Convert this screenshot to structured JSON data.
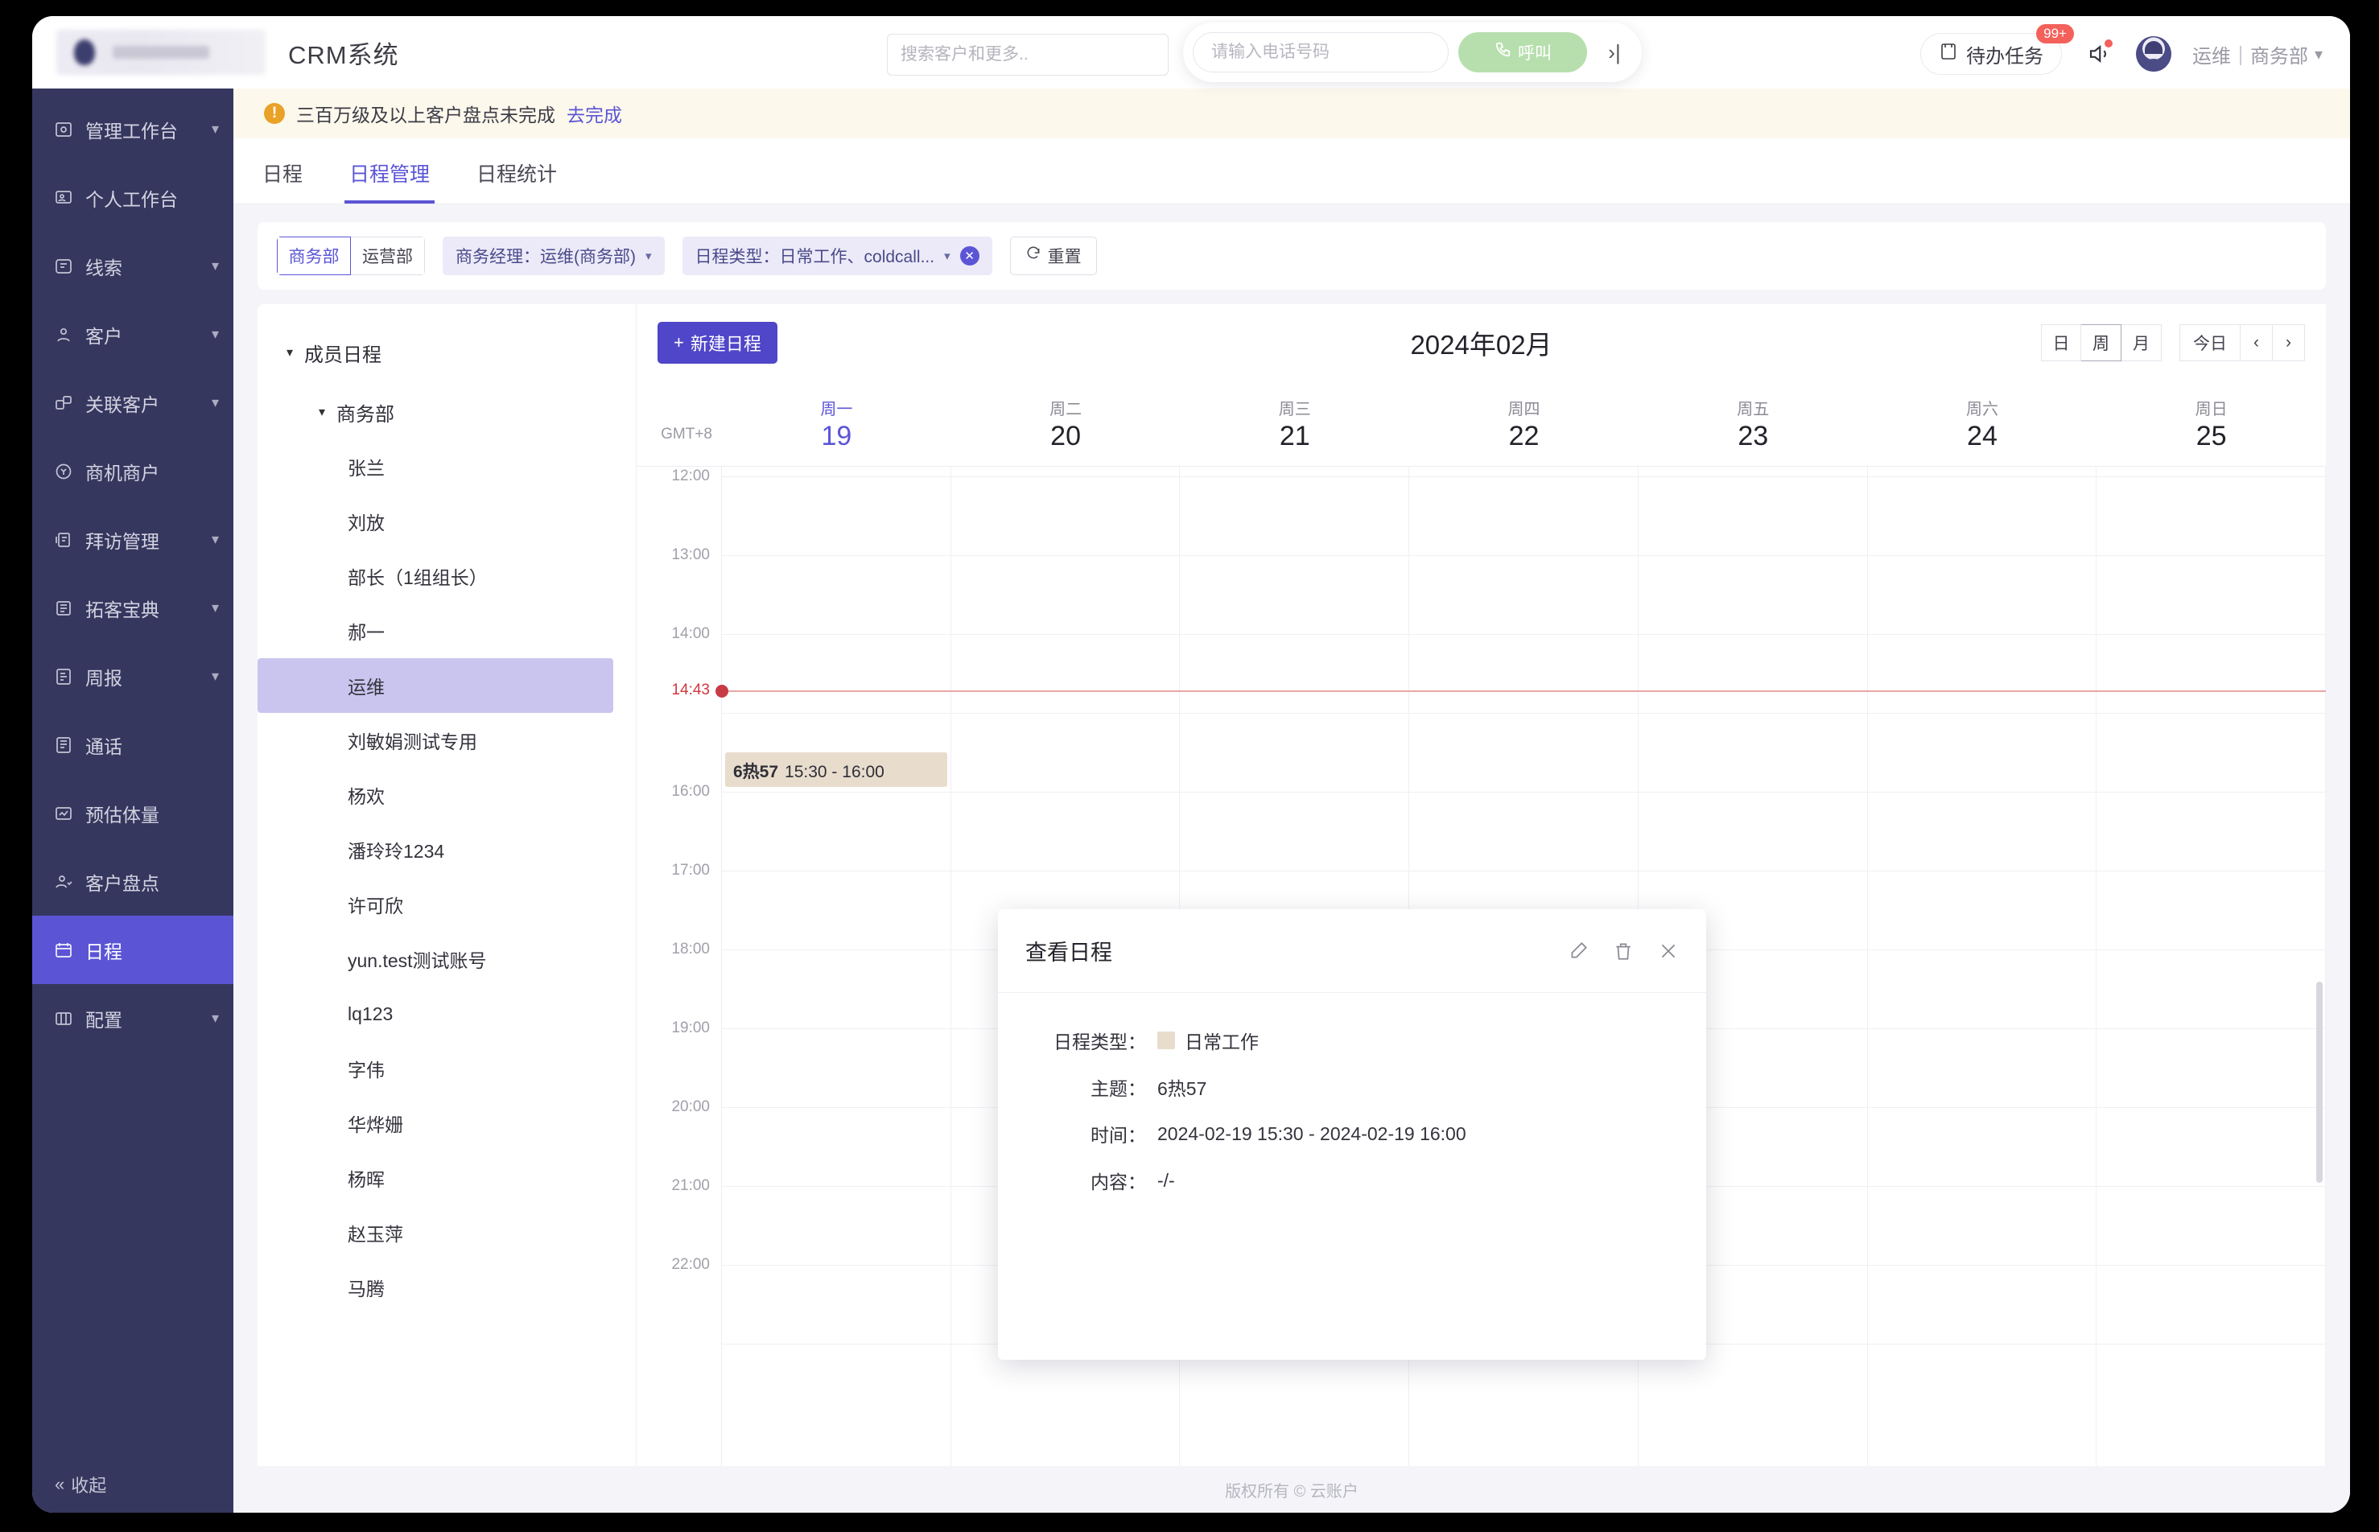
{
  "header": {
    "app_title": "CRM系统",
    "search_placeholder": "搜索客户和更多..",
    "search_value": "",
    "phone_placeholder": "请输入电话号码",
    "phone_value": "",
    "call_label": "呼叫",
    "collapse_icon": "chevron-right-icon",
    "todo_label": "待办任务",
    "todo_badge": "99+",
    "user_name": "运维｜商务部"
  },
  "sidebar": {
    "items": [
      {
        "label": "管理工作台",
        "icon": "dashboard-icon",
        "caret": true,
        "active": false
      },
      {
        "label": "个人工作台",
        "icon": "person-board-icon",
        "caret": false,
        "active": false
      },
      {
        "label": "线索",
        "icon": "clue-icon",
        "caret": true,
        "active": false
      },
      {
        "label": "客户",
        "icon": "customer-icon",
        "caret": true,
        "active": false
      },
      {
        "label": "关联客户",
        "icon": "related-customer-icon",
        "caret": true,
        "active": false
      },
      {
        "label": "商机商户",
        "icon": "opportunity-icon",
        "caret": false,
        "active": false
      },
      {
        "label": "拜访管理",
        "icon": "visit-icon",
        "caret": true,
        "active": false
      },
      {
        "label": "拓客宝典",
        "icon": "book-icon",
        "caret": true,
        "active": false
      },
      {
        "label": "周报",
        "icon": "report-icon",
        "caret": true,
        "active": false
      },
      {
        "label": "通话",
        "icon": "call-log-icon",
        "caret": false,
        "active": false
      },
      {
        "label": "预估体量",
        "icon": "estimate-icon",
        "caret": false,
        "active": false
      },
      {
        "label": "客户盘点",
        "icon": "inventory-icon",
        "caret": false,
        "active": false
      },
      {
        "label": "日程",
        "icon": "calendar-icon",
        "caret": false,
        "active": true
      },
      {
        "label": "配置",
        "icon": "config-icon",
        "caret": true,
        "active": false
      }
    ],
    "collapse_label": "收起"
  },
  "alert": {
    "text": "三百万级及以上客户盘点未完成",
    "link": "去完成"
  },
  "tabs": [
    {
      "label": "日程",
      "active": false
    },
    {
      "label": "日程管理",
      "active": true
    },
    {
      "label": "日程统计",
      "active": false
    }
  ],
  "filters": {
    "dept_segments": [
      {
        "label": "商务部",
        "active": true
      },
      {
        "label": "运营部",
        "active": false
      }
    ],
    "manager_filter": "商务经理：运维(商务部)",
    "type_filter": "日程类型：日常工作、coldcall...",
    "reset_label": "重置"
  },
  "tree": {
    "root": "成员日程",
    "group": "商务部",
    "members": [
      {
        "name": "张兰",
        "selected": false
      },
      {
        "name": "刘放",
        "selected": false
      },
      {
        "name": "部长（1组组长）",
        "selected": false
      },
      {
        "name": "郝一",
        "selected": false
      },
      {
        "name": "运维",
        "selected": true
      },
      {
        "name": "刘敏娟测试专用",
        "selected": false
      },
      {
        "name": "杨欢",
        "selected": false
      },
      {
        "name": "潘玲玲1234",
        "selected": false
      },
      {
        "name": "许可欣",
        "selected": false
      },
      {
        "name": "yun.test测试账号",
        "selected": false
      },
      {
        "name": "lq123",
        "selected": false
      },
      {
        "name": "字伟",
        "selected": false
      },
      {
        "name": "华烨姗",
        "selected": false
      },
      {
        "name": "杨晖",
        "selected": false
      },
      {
        "name": "赵玉萍",
        "selected": false
      },
      {
        "name": "马腾",
        "selected": false
      }
    ]
  },
  "calendar": {
    "new_button": "新建日程",
    "title": "2024年02月",
    "view_modes": [
      {
        "label": "日",
        "active": false
      },
      {
        "label": "周",
        "active": true
      },
      {
        "label": "月",
        "active": false
      }
    ],
    "today_label": "今日",
    "prev_icon": "chevron-left-icon",
    "next_icon": "chevron-right-icon",
    "timezone": "GMT+8",
    "days": [
      {
        "dow": "周一",
        "num": "19",
        "today": true
      },
      {
        "dow": "周二",
        "num": "20",
        "today": false
      },
      {
        "dow": "周三",
        "num": "21",
        "today": false
      },
      {
        "dow": "周四",
        "num": "22",
        "today": false
      },
      {
        "dow": "周五",
        "num": "23",
        "today": false
      },
      {
        "dow": "周六",
        "num": "24",
        "today": false
      },
      {
        "dow": "周日",
        "num": "25",
        "today": false
      }
    ],
    "hours": [
      "12:00",
      "13:00",
      "14:00",
      "16:00",
      "17:00",
      "18:00",
      "19:00",
      "20:00",
      "21:00",
      "22:00"
    ],
    "now_time": "14:43",
    "events": [
      {
        "title": "6热57",
        "time": "15:30 - 16:00",
        "day_index": 0
      }
    ]
  },
  "popup": {
    "title": "查看日程",
    "edit_icon": "pencil-icon",
    "delete_icon": "trash-icon",
    "close_icon": "close-icon",
    "type_label": "日程类型：",
    "type_value": "日常工作",
    "type_color": "#e8ddcd",
    "subject_label": "主题：",
    "subject_value": "6热57",
    "time_label": "时间：",
    "time_value": "2024-02-19 15:30  -  2024-02-19 16:00",
    "content_label": "内容：",
    "content_value": "-/-"
  },
  "footer": {
    "text": "版权所有 © 云账户"
  }
}
